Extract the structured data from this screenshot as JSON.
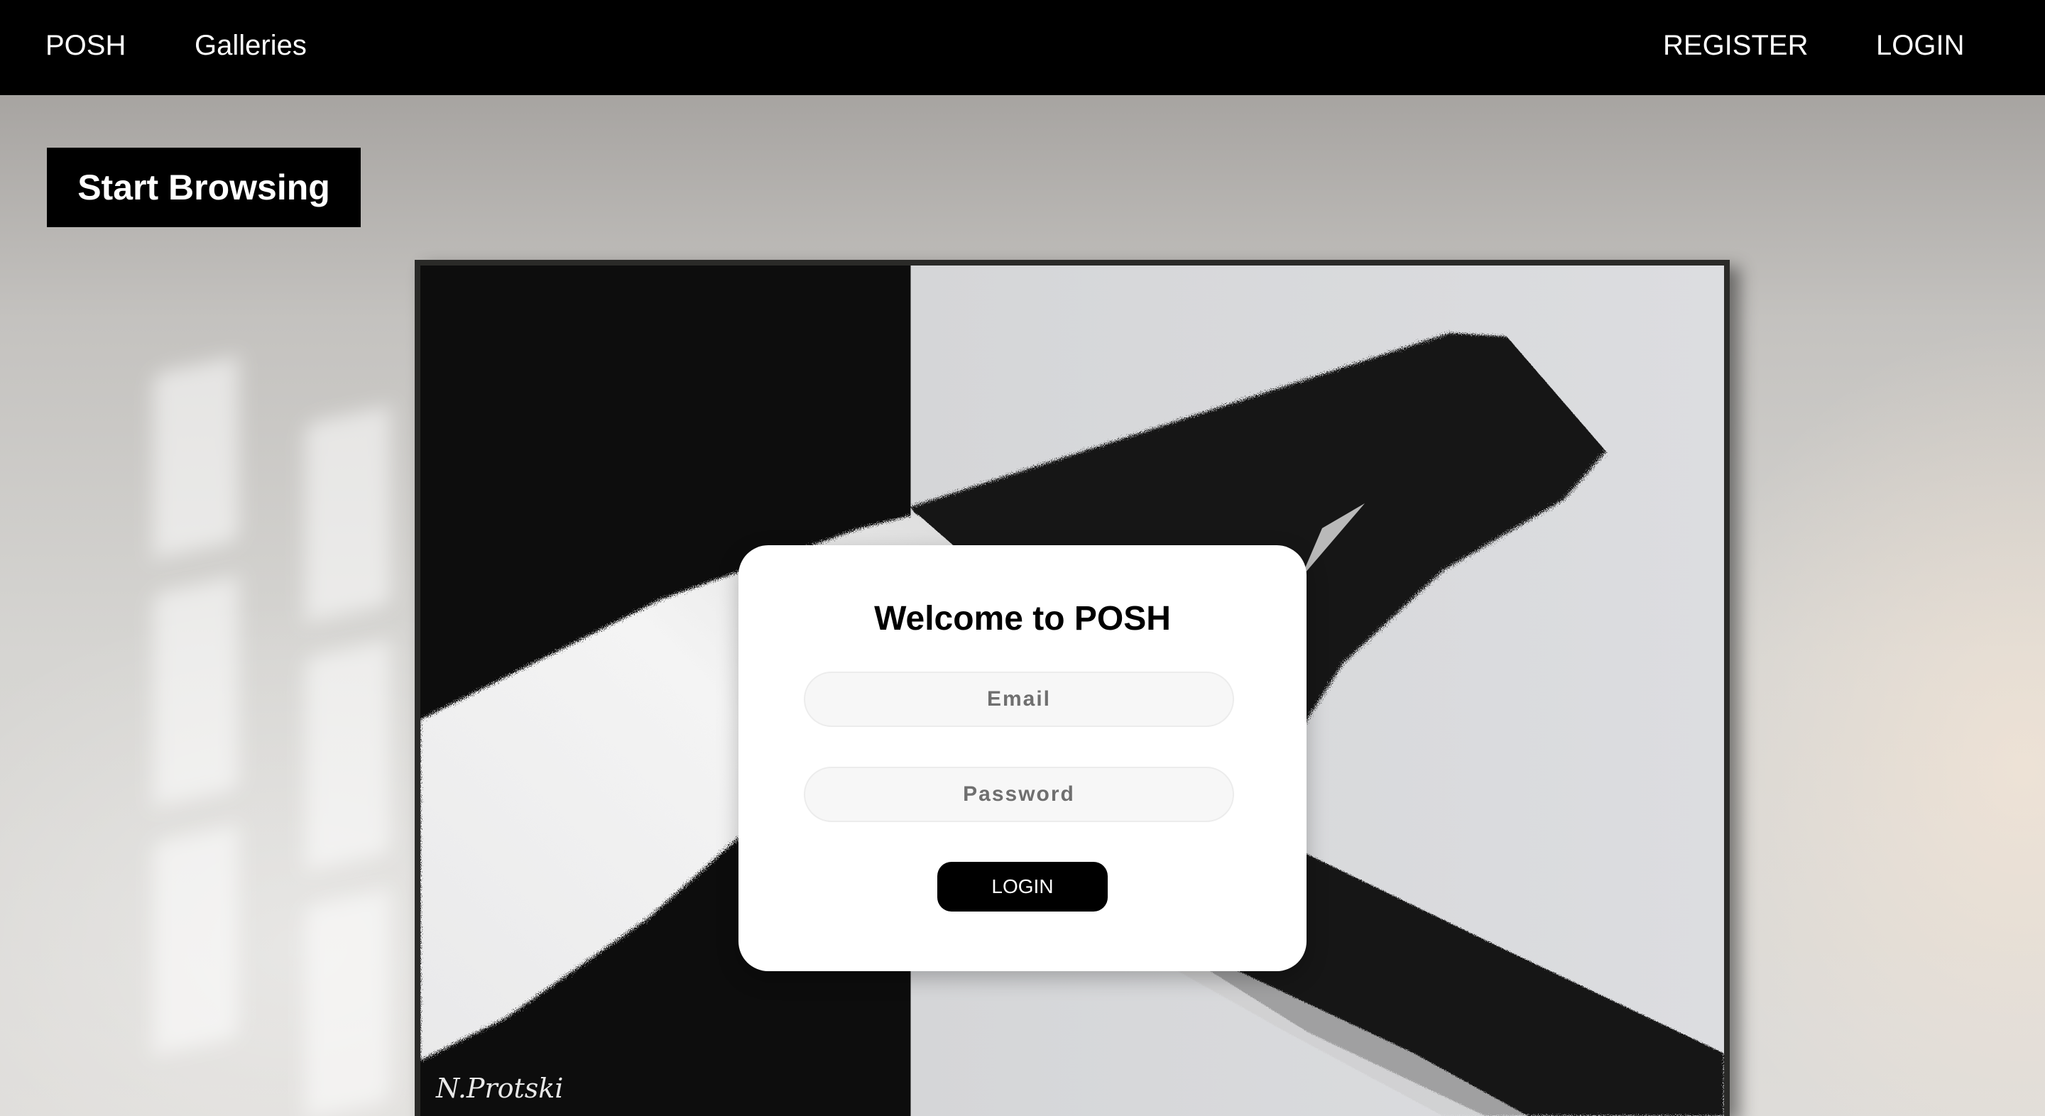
{
  "nav": {
    "brand": "POSH",
    "galleries": "Galleries",
    "register": "REGISTER",
    "login": "LOGIN"
  },
  "hero": {
    "start_browsing": "Start Browsing"
  },
  "painting": {
    "signature": "N.Protski"
  },
  "login_form": {
    "title": "Welcome to POSH",
    "email_placeholder": "Email",
    "email_value": "",
    "password_placeholder": "Password",
    "password_value": "",
    "submit_label": "LOGIN"
  },
  "colors": {
    "nav_background": "#000000",
    "button_background": "#000000",
    "card_background": "#ffffff"
  }
}
